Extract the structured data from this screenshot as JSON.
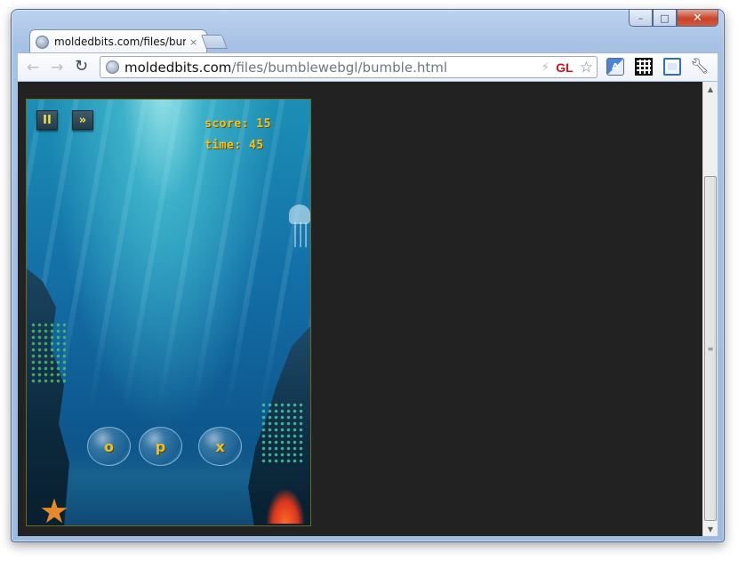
{
  "browser": {
    "tab_title": "moldedbits.com/files/bumb",
    "tab_close": "×",
    "url_host": "moldedbits.com",
    "url_path": "/files/bumblewebgl/bumble.html",
    "gl_badge": "GL",
    "translate_label": "A"
  },
  "window_controls": {
    "minimize": "–",
    "maximize": "□",
    "close": "✕"
  },
  "icons": {
    "back": "back-arrow-icon",
    "forward": "forward-arrow-icon",
    "reload": "reload-icon",
    "page": "globe-icon",
    "star": "bookmark-star-icon",
    "wrench": "wrench-icon"
  },
  "game": {
    "pause_label": "II",
    "fast_forward_label": "»",
    "score_text": "score: 15",
    "time_text": "time: 45",
    "bubbles": [
      "o",
      "p",
      "x"
    ]
  }
}
